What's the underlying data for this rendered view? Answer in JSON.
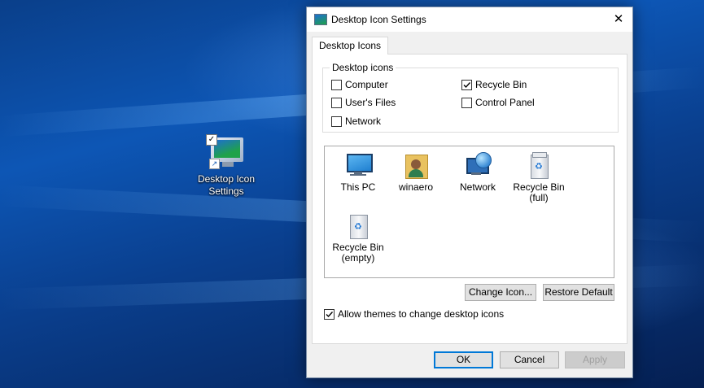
{
  "desktop": {
    "shortcut_label_line1": "Desktop Icon",
    "shortcut_label_line2": "Settings"
  },
  "dialog": {
    "title": "Desktop Icon Settings",
    "close_glyph": "✕",
    "tab_label": "Desktop Icons",
    "group_label": "Desktop icons",
    "checkboxes": {
      "computer": {
        "label": "Computer",
        "checked": false
      },
      "recycle_bin": {
        "label": "Recycle Bin",
        "checked": true
      },
      "users_files": {
        "label": "User's Files",
        "checked": false
      },
      "control_panel": {
        "label": "Control Panel",
        "checked": false
      },
      "network": {
        "label": "Network",
        "checked": false
      }
    },
    "icons": {
      "this_pc": {
        "line1": "This PC",
        "line2": ""
      },
      "winaero": {
        "line1": "winaero",
        "line2": ""
      },
      "network": {
        "line1": "Network",
        "line2": ""
      },
      "recycle_full": {
        "line1": "Recycle Bin",
        "line2": "(full)"
      },
      "recycle_empty": {
        "line1": "Recycle Bin",
        "line2": "(empty)"
      }
    },
    "change_icon_label": "Change Icon...",
    "restore_default_label": "Restore Default",
    "allow_themes": {
      "label": "Allow themes to change desktop icons",
      "checked": true
    },
    "ok_label": "OK",
    "cancel_label": "Cancel",
    "apply_label": "Apply"
  }
}
